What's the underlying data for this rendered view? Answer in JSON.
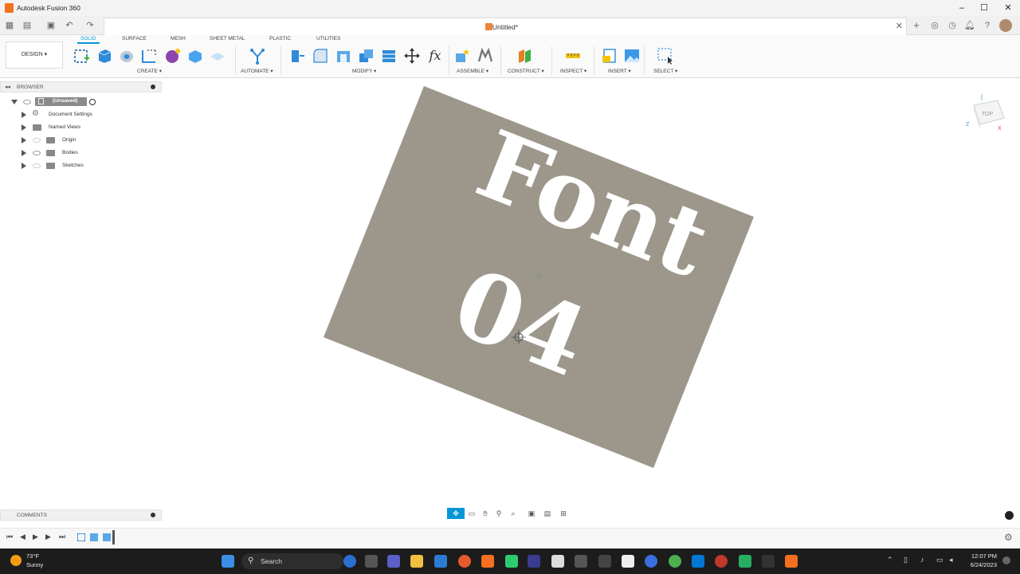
{
  "window": {
    "title": "Autodesk Fusion 360",
    "controls": [
      "–",
      "☐",
      "✕"
    ]
  },
  "document_tab": {
    "title": "Untitled*",
    "close": "✕"
  },
  "workspace": {
    "label": "DESIGN ▾"
  },
  "ribbon": {
    "tabs": [
      "SOLID",
      "SURFACE",
      "MESH",
      "SHEET METAL",
      "PLASTIC",
      "UTILITIES"
    ],
    "active_tab": "SOLID",
    "groups": {
      "create": "CREATE ▾",
      "automate": "AUTOMATE ▾",
      "modify": "MODIFY ▾",
      "assemble": "ASSEMBLE ▾",
      "construct": "CONSTRUCT ▾",
      "inspect": "INSPECT ▾",
      "insert": "INSERT ▾",
      "select": "SELECT ▾"
    },
    "fx_label": "fx"
  },
  "browser": {
    "title": "BROWSER",
    "root": "(Unsaved)",
    "items": [
      {
        "label": "Document Settings"
      },
      {
        "label": "Named Views"
      },
      {
        "label": "Origin"
      },
      {
        "label": "Bodies"
      },
      {
        "label": "Sketches"
      }
    ]
  },
  "comments": {
    "title": "COMMENTS"
  },
  "viewport": {
    "plate_color": "#9c978a",
    "text_line1": "Font",
    "text_line2": "04",
    "viewcube_label": "TOP",
    "axis_x": "X",
    "axis_z": "Z"
  },
  "taskbar": {
    "weather_temp": "73°F",
    "weather_desc": "Sunny",
    "search_label": "Search",
    "time": "12:07 PM",
    "date": "6/24/2023"
  }
}
